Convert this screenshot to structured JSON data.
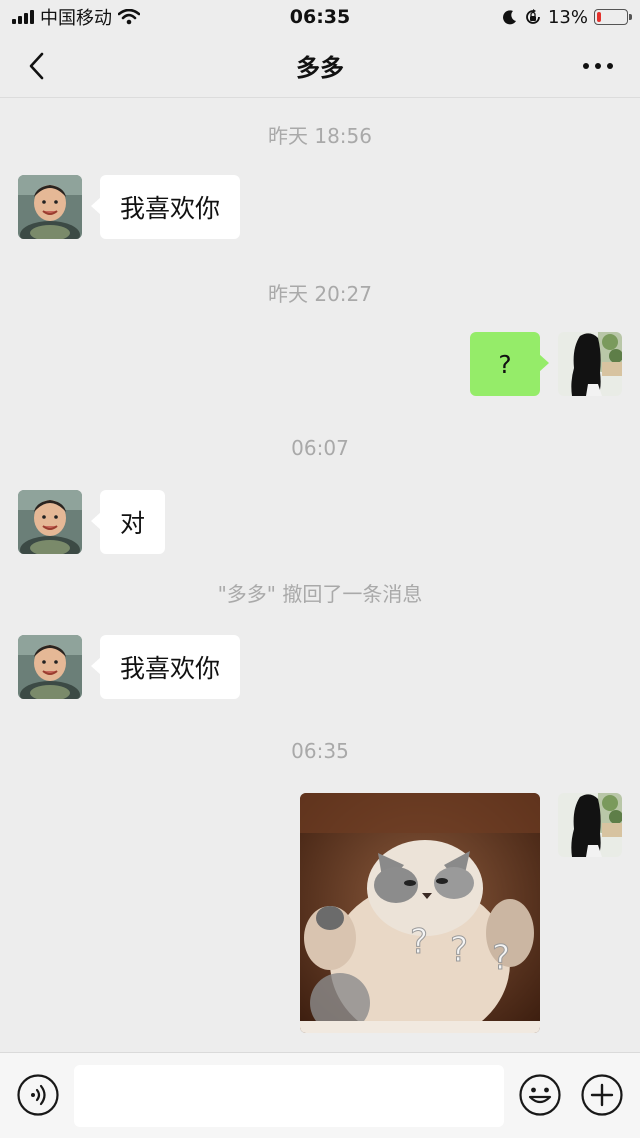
{
  "status_bar": {
    "carrier": "中国移动",
    "time": "06:35",
    "battery_percent": "13%",
    "battery_level": 0.13,
    "icons": [
      "signal-icon",
      "wifi-icon",
      "moon-icon",
      "orientation-lock-icon",
      "battery-icon"
    ]
  },
  "header": {
    "title": "多多",
    "back_icon": "chevron-left-icon",
    "more_icon": "more-dots-icon"
  },
  "messages": [
    {
      "type": "timestamp",
      "text": "昨天 18:56"
    },
    {
      "type": "text",
      "side": "left",
      "text": "我喜欢你",
      "avatar": "baby-avatar"
    },
    {
      "type": "timestamp",
      "text": "昨天 20:27"
    },
    {
      "type": "text",
      "side": "right",
      "text": "?",
      "avatar": "girl-avatar"
    },
    {
      "type": "timestamp",
      "text": "06:07"
    },
    {
      "type": "text",
      "side": "left",
      "text": "对",
      "avatar": "baby-avatar"
    },
    {
      "type": "system",
      "text": "\"多多\" 撤回了一条消息"
    },
    {
      "type": "text",
      "side": "left",
      "text": "我喜欢你",
      "avatar": "baby-avatar"
    },
    {
      "type": "timestamp",
      "text": "06:35"
    },
    {
      "type": "image",
      "side": "right",
      "content": "cat-sticker",
      "overlay": "? ? ?",
      "avatar": "girl-avatar"
    }
  ],
  "input_bar": {
    "voice_icon": "voice-icon",
    "text_value": "",
    "emoji_icon": "emoji-icon",
    "plus_icon": "plus-icon"
  },
  "colors": {
    "background": "#ededed",
    "outgoing_bubble": "#95ec69",
    "incoming_bubble": "#ffffff",
    "timestamp_text": "#a9a9a9",
    "battery_low": "#e3322d"
  }
}
